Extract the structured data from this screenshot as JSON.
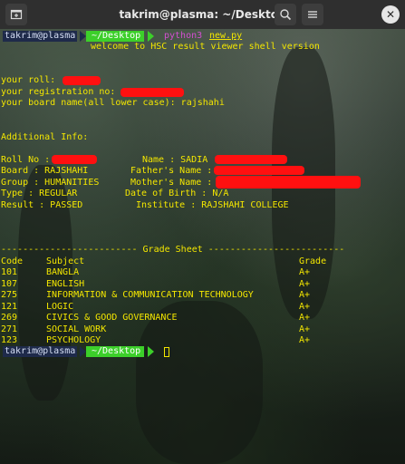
{
  "window": {
    "title": "takrim@plasma: ~/Desktop",
    "new_tab_icon": "new-tab-icon",
    "search_icon": "search-icon",
    "menu_icon": "hamburger-menu-icon",
    "close_label": "✕"
  },
  "prompt": {
    "user": "takrim@plasma",
    "path": "~/Desktop",
    "command": "python3",
    "argument": "new.py"
  },
  "output": {
    "welcome": "welcome to HSC result viewer shell version",
    "roll_prompt": "your roll: ",
    "registration_prompt": "your registration no: ",
    "board_prompt": "your board name(all lower case): rajshahi",
    "additional_info": "Additional Info:",
    "roll_no": "Roll No : ",
    "name": "Name : SADIA ",
    "board": "Board : RAJSHAHI",
    "fathers_name": "Father's Name : ",
    "group": "Group : HUMANITIES",
    "mothers_name": "Mother's Name : ",
    "type": "Type : REGULAR",
    "dob": "Date of Birth : N/A",
    "result": "Result : PASSED",
    "institute": "Institute : RAJSHAHI COLLEGE",
    "grade_sheet_header": "------------------------- Grade Sheet -------------------------",
    "columns": {
      "code": "Code",
      "subject": "Subject",
      "grade": "Grade"
    },
    "grades": [
      {
        "code": "101",
        "subject": "BANGLA",
        "grade": "A+"
      },
      {
        "code": "107",
        "subject": "ENGLISH",
        "grade": "A+"
      },
      {
        "code": "275",
        "subject": "INFORMATION & COMMUNICATION TECHNOLOGY",
        "grade": "A+"
      },
      {
        "code": "121",
        "subject": "LOGIC",
        "grade": "A+"
      },
      {
        "code": "269",
        "subject": "CIVICS & GOOD GOVERNANCE",
        "grade": "A+"
      },
      {
        "code": "271",
        "subject": "SOCIAL WORK",
        "grade": "A+"
      },
      {
        "code": "123",
        "subject": "PSYCHOLOGY",
        "grade": "A+"
      }
    ]
  },
  "colors": {
    "terminal_text": "#f3e600",
    "prompt_user_bg": "#1e2a4a",
    "prompt_path_bg": "#3ccf2a",
    "command": "#d24fd0",
    "redaction": "#ff1010"
  }
}
